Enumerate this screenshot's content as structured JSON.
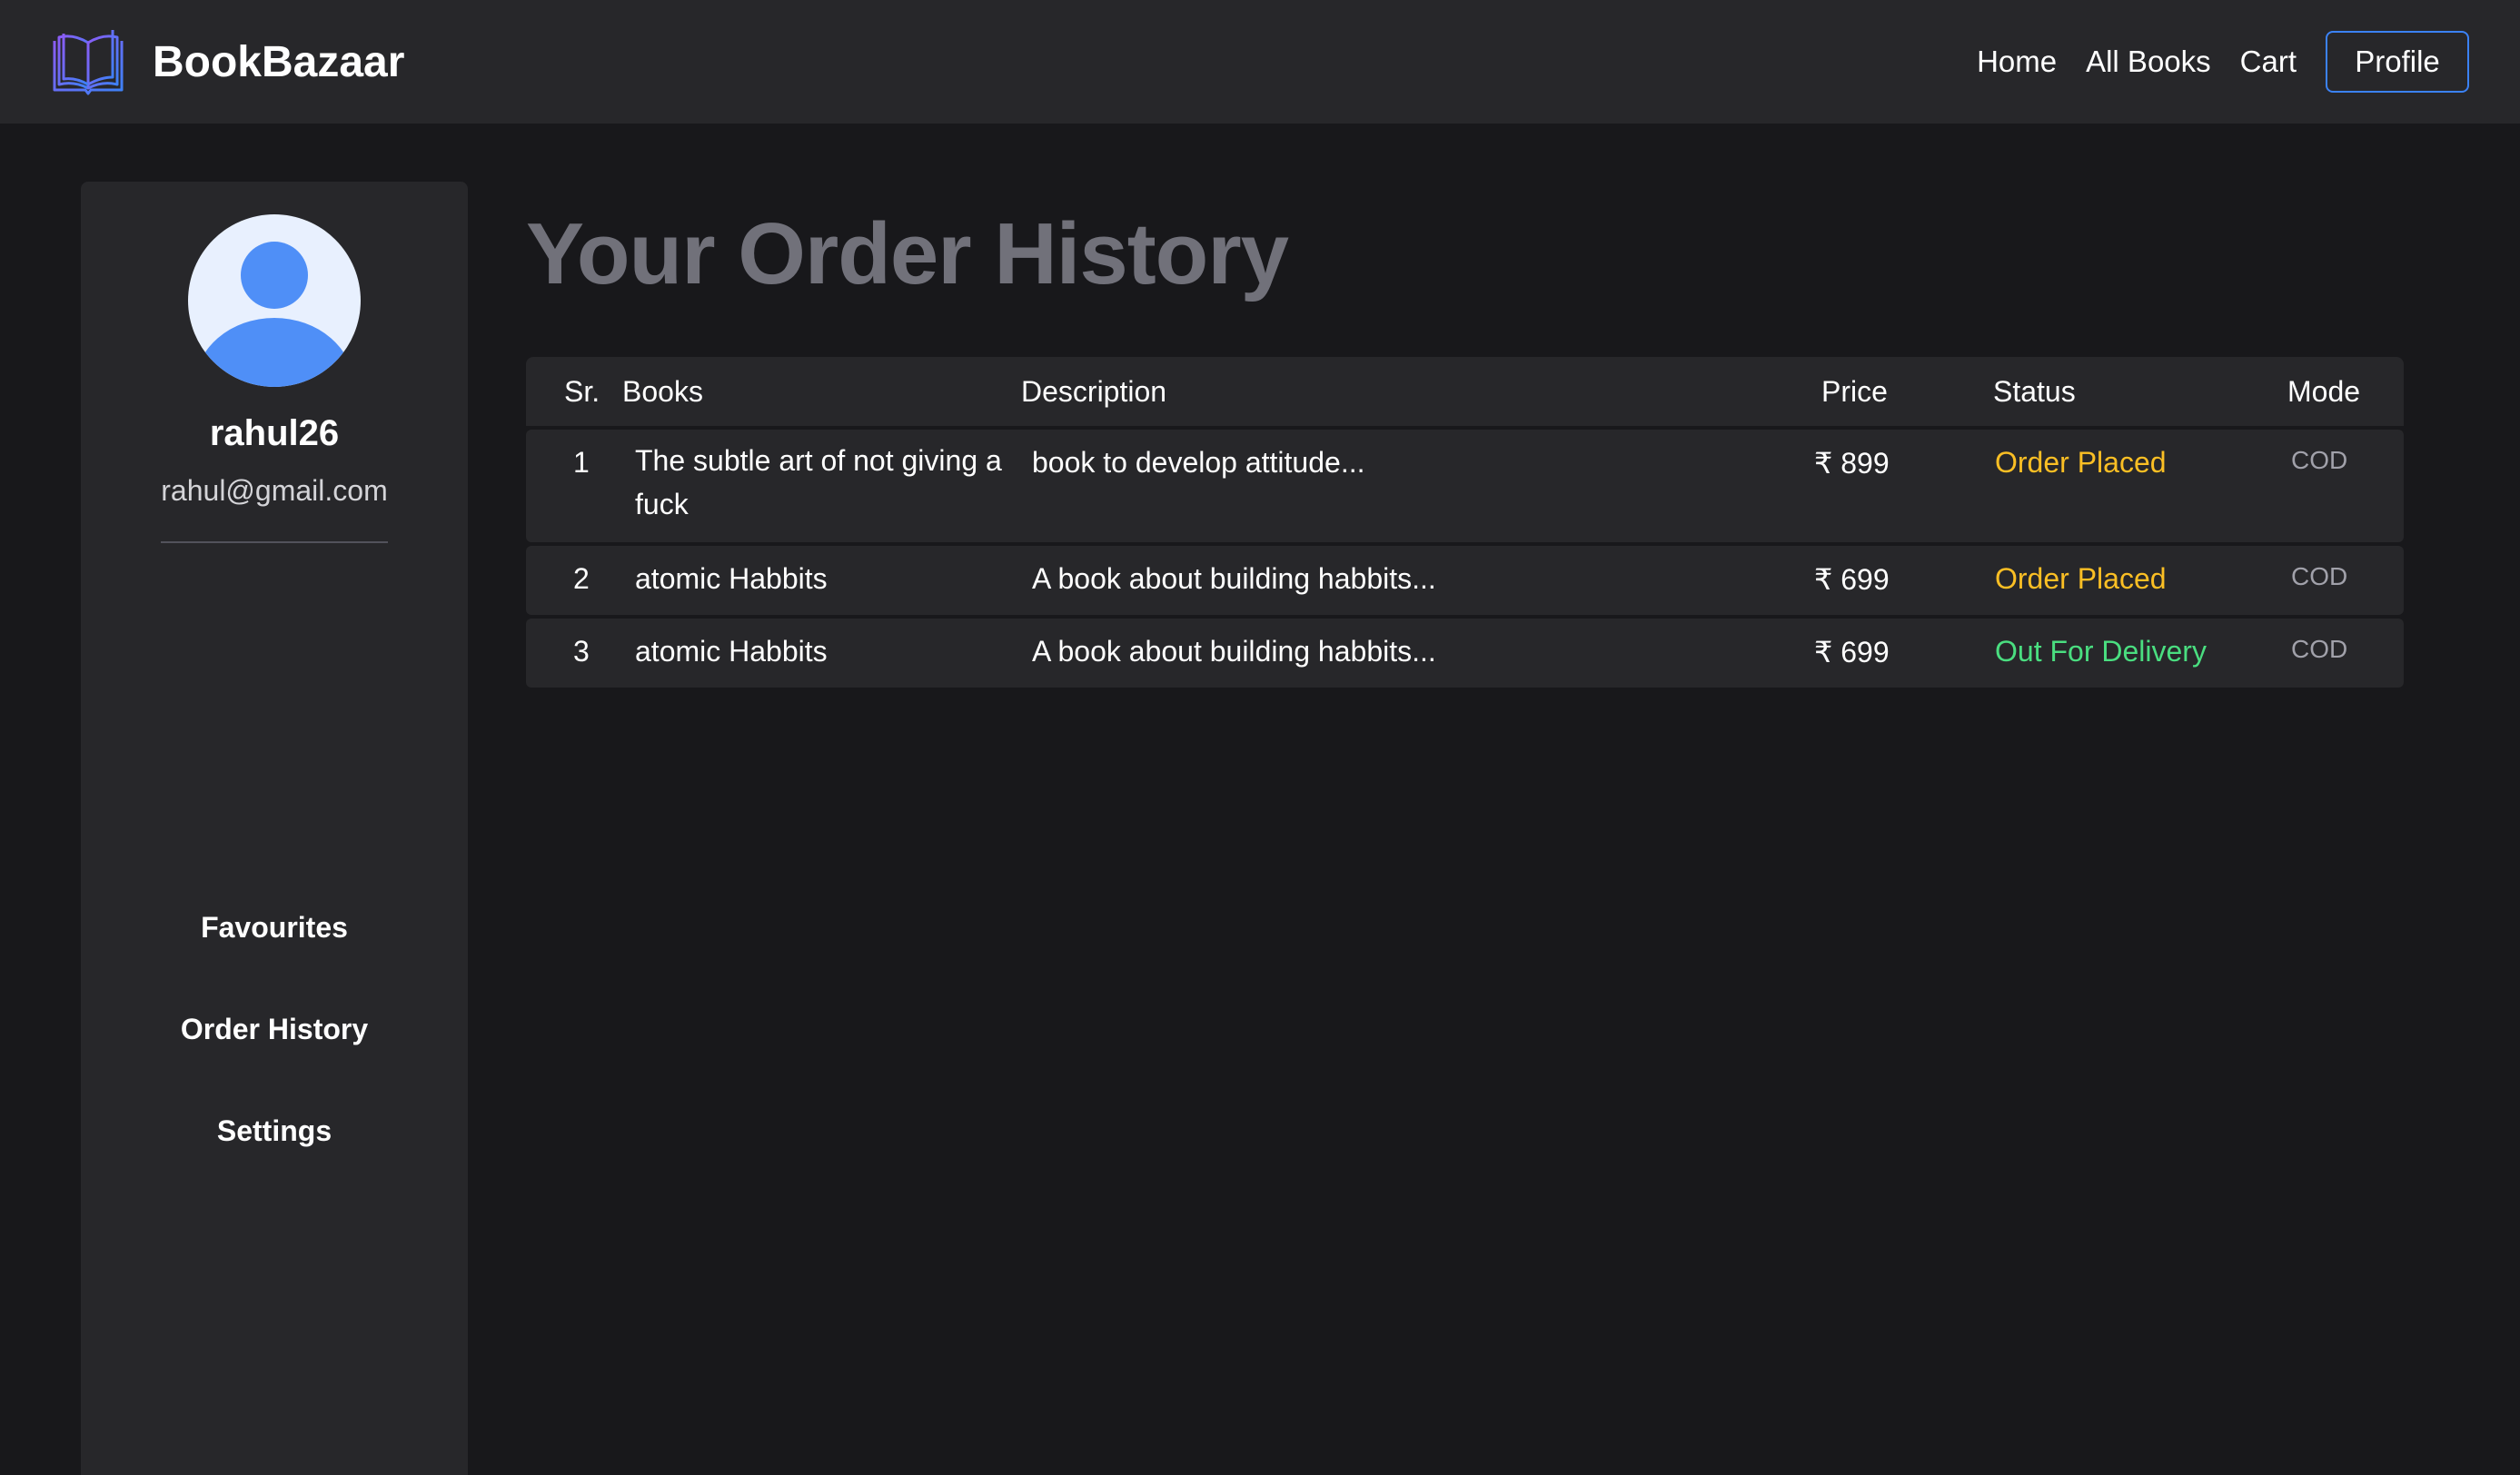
{
  "navbar": {
    "brand": "BookBazaar",
    "brand_icon": "open-book-icon",
    "links": [
      "Home",
      "All Books",
      "Cart"
    ],
    "profile_label": "Profile"
  },
  "sidebar": {
    "avatar_icon": "user-avatar-icon",
    "username": "rahul26",
    "email": "rahul@gmail.com",
    "items": [
      "Favourites",
      "Order History",
      "Settings"
    ]
  },
  "main": {
    "title": "Your Order History",
    "columns": [
      "Sr.",
      "Books",
      "Description",
      "Price",
      "Status",
      "Mode"
    ],
    "rows": [
      {
        "sr": "1",
        "book": "The subtle art of not giving a fuck",
        "description": "book to develop attitude...",
        "price": "₹ 899",
        "status": "Order Placed",
        "mode": "COD"
      },
      {
        "sr": "2",
        "book": "atomic Habbits",
        "description": "A book about building habbits...",
        "price": "₹ 699",
        "status": "Order Placed",
        "mode": "COD"
      },
      {
        "sr": "3",
        "book": "atomic Habbits",
        "description": "A book about building habbits...",
        "price": "₹ 699",
        "status": "Out For Delivery",
        "mode": "COD"
      }
    ]
  },
  "colors": {
    "background": "#18181b",
    "panel": "#27272a",
    "accent": "#3b82f6",
    "status_placed": "#fbbf24",
    "status_delivery": "#4ade80"
  }
}
